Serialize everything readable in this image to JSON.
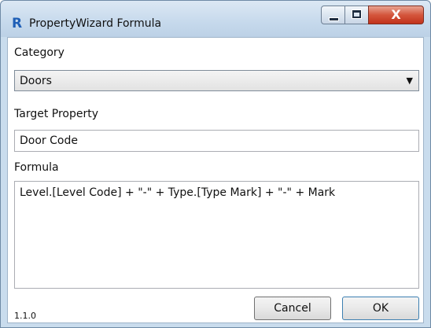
{
  "window": {
    "title": "PropertyWizard Formula",
    "app_icon_letter": "R",
    "caption": {
      "close_symbol": "X"
    }
  },
  "category": {
    "label": "Category",
    "selected": "Doors"
  },
  "target_property": {
    "label": "Target Property",
    "value": "Door Code"
  },
  "formula": {
    "label": "Formula",
    "value": "Level.[Level Code] + \"-\" + Type.[Type Mark] + \"-\" + Mark"
  },
  "footer": {
    "version": "1.1.0",
    "cancel_label": "Cancel",
    "ok_label": "OK"
  },
  "colors": {
    "accent": "#3c7fb1",
    "close_button": "#c2321b",
    "titlebar": "#c9dced"
  }
}
